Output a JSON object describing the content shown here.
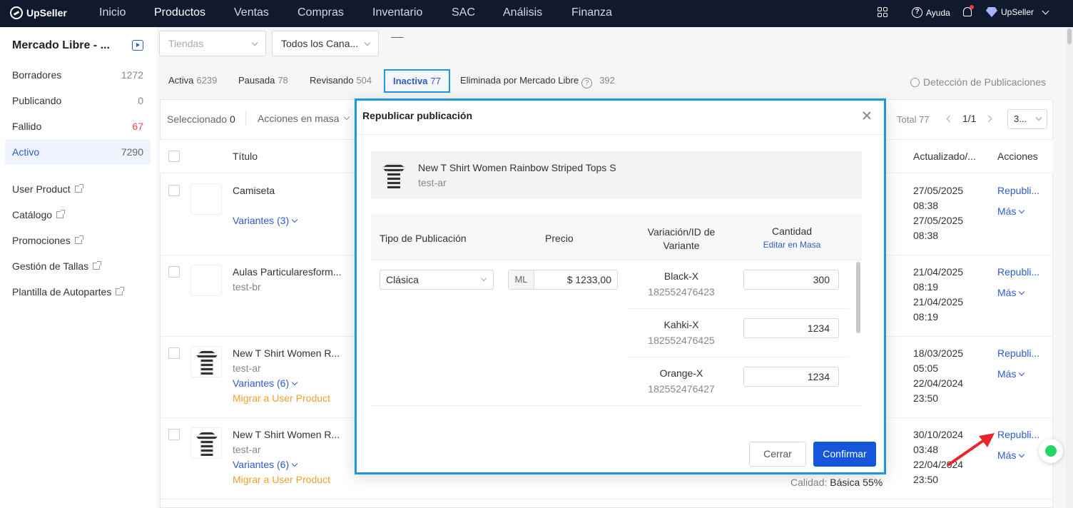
{
  "brand": "UpSeller",
  "nav": [
    "Inicio",
    "Productos",
    "Ventas",
    "Compras",
    "Inventario",
    "SAC",
    "Análisis",
    "Finanza"
  ],
  "nav_active": "Productos",
  "nav_right": {
    "help": "Ayuda",
    "account": "UpSeller"
  },
  "sidebar": {
    "title": "Mercado Libre - ...",
    "items": [
      {
        "label": "Borradores",
        "count": "1272"
      },
      {
        "label": "Publicando",
        "count": "0"
      },
      {
        "label": "Fallido",
        "count": "67"
      },
      {
        "label": "Activo",
        "count": "7290"
      }
    ],
    "links": [
      "User Product",
      "Catálogo",
      "Promociones",
      "Gestión de Tallas",
      "Plantilla de Autopartes"
    ]
  },
  "filters": {
    "stores_placeholder": "Tiendas",
    "channels": "Todos los Cana..."
  },
  "tabs": [
    {
      "label": "Activa",
      "count": "6239"
    },
    {
      "label": "Pausada",
      "count": "78"
    },
    {
      "label": "Revisando",
      "count": "504"
    },
    {
      "label": "Inactiva",
      "count": "77"
    },
    {
      "label": "Eliminada por Mercado Libre",
      "count": "392"
    }
  ],
  "detect_label": "Detección de Publicaciones",
  "toolbar": {
    "selected_label": "Seleccionado",
    "selected_count": "0",
    "bulk_actions": "Acciones en masa",
    "total": "Total 77",
    "page": "1/1",
    "page_size": "3..."
  },
  "columns": {
    "title": "Título",
    "updated": "Actualizado/...",
    "actions": "Acciones"
  },
  "rows": [
    {
      "title": "Camiseta",
      "shop": "",
      "variants": "Variantes (3)",
      "migrate": "",
      "updated": [
        "27/05/2025",
        "08:38",
        "27/05/2025",
        "08:38"
      ],
      "action": "Republi...",
      "more": "Más"
    },
    {
      "title": "Aulas Particularesform...",
      "shop": "test-br",
      "variants": "",
      "migrate": "",
      "updated": [
        "21/04/2025",
        "08:19",
        "21/04/2025",
        "08:19"
      ],
      "action": "Republi...",
      "more": "Más"
    },
    {
      "title": "New T Shirt Women R...",
      "shop": "test-ar",
      "variants": "Variantes (6)",
      "migrate": "Migrar a User Product",
      "updated": [
        "18/03/2025",
        "05:05",
        "22/04/2024",
        "23:50"
      ],
      "action": "Republi...",
      "more": "Más"
    },
    {
      "title": "New T Shirt Women R...",
      "shop": "test-ar",
      "variants": "Variantes (6)",
      "migrate": "Migrar a User Product",
      "updated": [
        "30/10/2024",
        "03:48",
        "22/04/2024",
        "23:50"
      ],
      "action": "Republi...",
      "more": "Más"
    }
  ],
  "quality": {
    "label": "Calidad:",
    "value": "Básica 55%"
  },
  "dialog": {
    "title": "Republicar publicación",
    "product_name": "New T Shirt Women Rainbow Striped Tops S",
    "product_shop": "test-ar",
    "headers": {
      "type": "Tipo de Publicación",
      "price": "Precio",
      "variation": "Variación/ID de Variante",
      "qty": "Cantidad",
      "bulk_edit": "Editar en Masa"
    },
    "type_value": "Clásica",
    "currency": "ML",
    "price_value": "$ 1233,00",
    "variants": [
      {
        "name": "Black-X",
        "id": "182552476423",
        "qty": "300"
      },
      {
        "name": "Kahki-X",
        "id": "182552476425",
        "qty": "1234"
      },
      {
        "name": "Orange-X",
        "id": "182552476427",
        "qty": "1234"
      }
    ],
    "cancel": "Cerrar",
    "confirm": "Confirmar"
  },
  "colors": {
    "nav_bg": "#111a2c",
    "accent": "#2d5ccf",
    "highlight": "#1d97e0",
    "primary_button": "#1656d9",
    "warning": "#f0a030",
    "error": "#e8474f"
  }
}
